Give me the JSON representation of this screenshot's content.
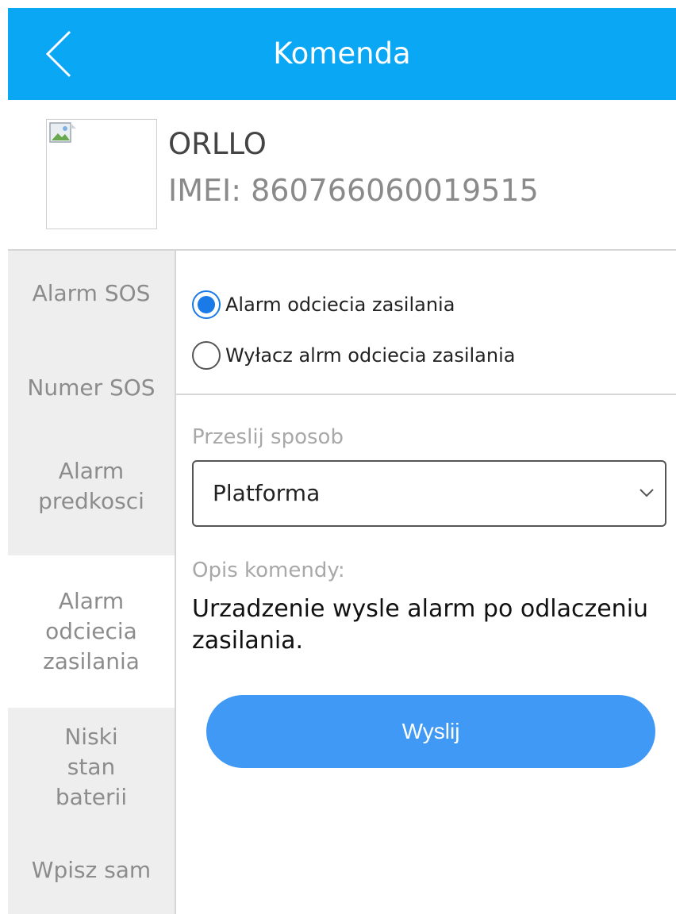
{
  "header": {
    "title": "Komenda",
    "back_icon": "chevron-left-icon",
    "background_color": "#0aa7f5"
  },
  "device": {
    "name": "ORLLO",
    "imei": "IMEI:  860766060019515",
    "thumbnail_icon": "broken-image-icon"
  },
  "sidebar": {
    "items": [
      {
        "label": "Alarm SOS",
        "active": false
      },
      {
        "label": "Numer SOS",
        "active": false
      },
      {
        "label": "Alarm predkosci",
        "active": false
      },
      {
        "label": "Alarm odciecia zasilania",
        "active": true
      },
      {
        "label": "Niski stan baterii",
        "active": false
      },
      {
        "label": "Wpisz sam",
        "active": false
      }
    ]
  },
  "options": [
    {
      "label": "Alarm odciecia zasilania",
      "checked": true
    },
    {
      "label": "Wyłacz alrm odciecia zasilania",
      "checked": false
    }
  ],
  "send_method": {
    "label": "Przeslij sposob",
    "selected": "Platforma",
    "chevron_icon": "chevron-down-icon"
  },
  "description": {
    "label": "Opis komendy:",
    "text": "Urzadzenie wysle alarm po odlaczeniu zasilania."
  },
  "submit": {
    "label": "Wyslij",
    "color": "#4099f5"
  },
  "accent_color": "#1a7ae8"
}
